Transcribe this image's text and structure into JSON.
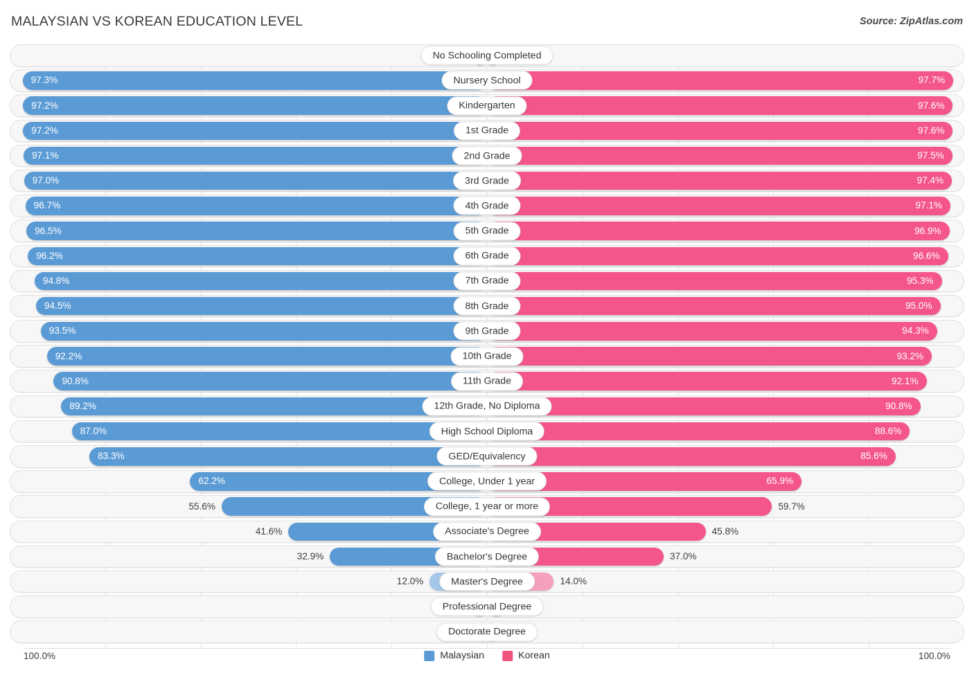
{
  "header": {
    "title": "MALAYSIAN VS KOREAN EDUCATION LEVEL",
    "source": "Source: ZipAtlas.com"
  },
  "axis": {
    "left_end": "100.0%",
    "right_end": "100.0%"
  },
  "legend": [
    {
      "label": "Malaysian",
      "color": "#5b9bd5"
    },
    {
      "label": "Korean",
      "color": "#f2547d"
    }
  ],
  "colors": {
    "left_strong": "#5b9bd5",
    "left_soft": "#a4c7e9",
    "right_strong": "#f4558b",
    "right_soft": "#f5a0bf",
    "track": "#f7f7f7",
    "track_border": "#e0e0e0"
  },
  "chart_data": {
    "type": "bar",
    "subtype": "diverging-bar",
    "title": "MALAYSIAN VS KOREAN EDUCATION LEVEL",
    "xlabel": "",
    "ylabel": "",
    "xlim": [
      0,
      100
    ],
    "unit": "%",
    "grid": true,
    "legend_position": "bottom-center",
    "categories": [
      "No Schooling Completed",
      "Nursery School",
      "Kindergarten",
      "1st Grade",
      "2nd Grade",
      "3rd Grade",
      "4th Grade",
      "5th Grade",
      "6th Grade",
      "7th Grade",
      "8th Grade",
      "9th Grade",
      "10th Grade",
      "11th Grade",
      "12th Grade, No Diploma",
      "High School Diploma",
      "GED/Equivalency",
      "College, Under 1 year",
      "College, 1 year or more",
      "Associate's Degree",
      "Bachelor's Degree",
      "Master's Degree",
      "Professional Degree",
      "Doctorate Degree"
    ],
    "series": [
      {
        "name": "Malaysian",
        "side": "left",
        "color": "#5b9bd5",
        "values": [
          2.8,
          97.3,
          97.2,
          97.2,
          97.1,
          97.0,
          96.7,
          96.5,
          96.2,
          94.8,
          94.5,
          93.5,
          92.2,
          90.8,
          89.2,
          87.0,
          83.3,
          62.2,
          55.6,
          41.6,
          32.9,
          12.0,
          3.4,
          1.5
        ],
        "labels": [
          "2.8%",
          "97.3%",
          "97.2%",
          "97.2%",
          "97.1%",
          "97.0%",
          "96.7%",
          "96.5%",
          "96.2%",
          "94.8%",
          "94.5%",
          "93.5%",
          "92.2%",
          "90.8%",
          "89.2%",
          "87.0%",
          "83.3%",
          "62.2%",
          "55.6%",
          "41.6%",
          "32.9%",
          "12.0%",
          "3.4%",
          "1.5%"
        ]
      },
      {
        "name": "Korean",
        "side": "right",
        "color": "#f4558b",
        "values": [
          2.4,
          97.7,
          97.6,
          97.6,
          97.5,
          97.4,
          97.1,
          96.9,
          96.6,
          95.3,
          95.0,
          94.3,
          93.2,
          92.1,
          90.8,
          88.6,
          85.6,
          65.9,
          59.7,
          45.8,
          37.0,
          14.0,
          4.1,
          1.7
        ],
        "labels": [
          "2.4%",
          "97.7%",
          "97.6%",
          "97.6%",
          "97.5%",
          "97.4%",
          "97.1%",
          "96.9%",
          "96.6%",
          "95.3%",
          "95.0%",
          "94.3%",
          "93.2%",
          "92.1%",
          "90.8%",
          "88.6%",
          "85.6%",
          "65.9%",
          "59.7%",
          "45.8%",
          "37.0%",
          "14.0%",
          "4.1%",
          "1.7%"
        ]
      }
    ]
  }
}
